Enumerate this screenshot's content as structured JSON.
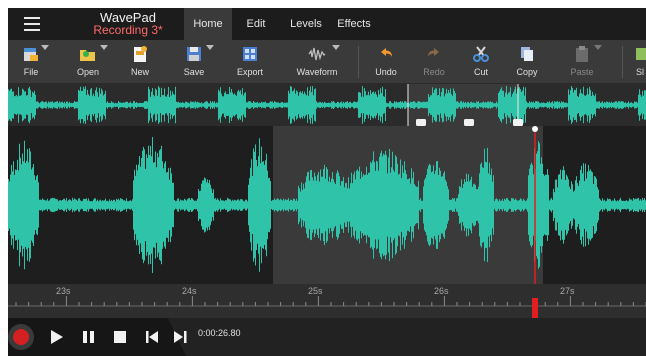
{
  "app": {
    "name": "WavePad",
    "recording": "Recording 3*"
  },
  "tabs": [
    {
      "label": "Home",
      "active": true
    },
    {
      "label": "Edit",
      "active": false
    },
    {
      "label": "Levels",
      "active": false
    },
    {
      "label": "Effects",
      "active": false
    }
  ],
  "toolbar": {
    "file": "File",
    "open": "Open",
    "new": "New",
    "save": "Save",
    "export": "Export",
    "waveform": "Waveform",
    "undo": "Undo",
    "redo": "Redo",
    "cut": "Cut",
    "copy": "Copy",
    "paste": "Paste",
    "more": "Sl"
  },
  "timeline": {
    "ticks": [
      "23s",
      "24s",
      "25s",
      "26s",
      "27s"
    ]
  },
  "transport": {
    "time": "0:00:26.80"
  },
  "colors": {
    "wave": "#2fc4a9",
    "accent_red": "#e02020",
    "recording_title": "#ff6b6b"
  }
}
